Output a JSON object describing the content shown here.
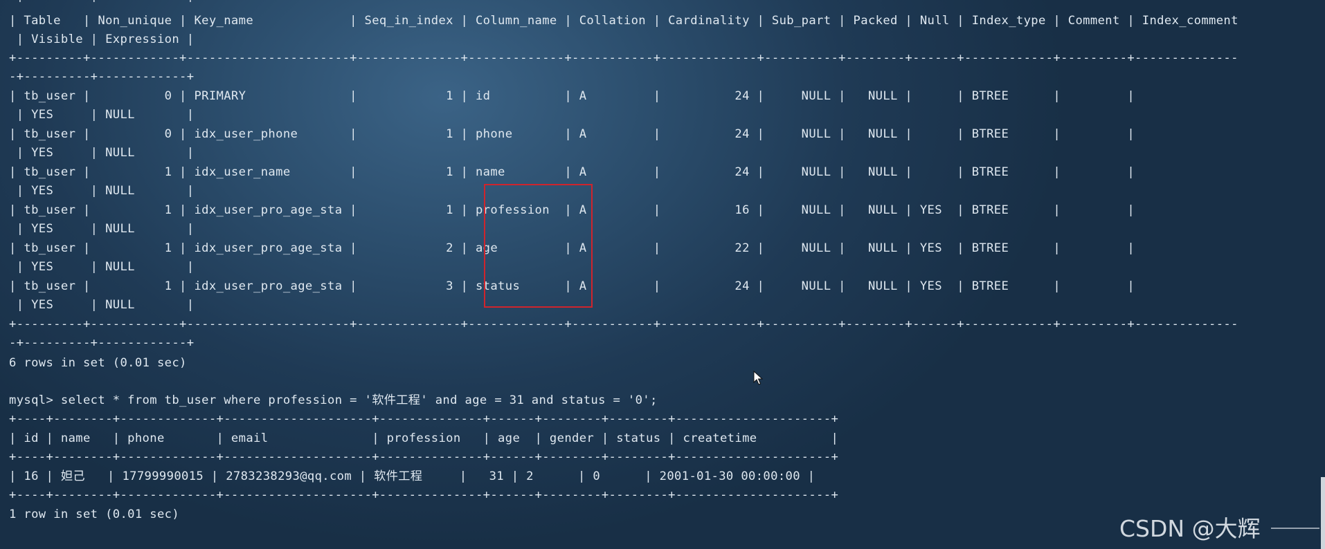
{
  "terminal": {
    "lines": [
      "-+---------+------------+",
      "| Table   | Non_unique | Key_name             | Seq_in_index | Column_name | Collation | Cardinality | Sub_part | Packed | Null | Index_type | Comment | Index_comment",
      " | Visible | Expression |",
      "+---------+------------+----------------------+--------------+-------------+-----------+-------------+----------+--------+------+------------+---------+--------------",
      "-+---------+------------+",
      "| tb_user |          0 | PRIMARY              |            1 | id          | A         |          24 |     NULL |   NULL |      | BTREE      |         |",
      " | YES     | NULL       |",
      "| tb_user |          0 | idx_user_phone       |            1 | phone       | A         |          24 |     NULL |   NULL |      | BTREE      |         |",
      " | YES     | NULL       |",
      "| tb_user |          1 | idx_user_name        |            1 | name        | A         |          24 |     NULL |   NULL |      | BTREE      |         |",
      " | YES     | NULL       |",
      "| tb_user |          1 | idx_user_pro_age_sta |            1 | profession  | A         |          16 |     NULL |   NULL | YES  | BTREE      |         |",
      " | YES     | NULL       |",
      "| tb_user |          1 | idx_user_pro_age_sta |            2 | age         | A         |          22 |     NULL |   NULL | YES  | BTREE      |         |",
      " | YES     | NULL       |",
      "| tb_user |          1 | idx_user_pro_age_sta |            3 | status      | A         |          24 |     NULL |   NULL | YES  | BTREE      |         |",
      " | YES     | NULL       |",
      "+---------+------------+----------------------+--------------+-------------+-----------+-------------+----------+--------+------+------------+---------+--------------",
      "-+---------+------------+",
      "6 rows in set (0.01 sec)",
      "",
      "mysql> select * from tb_user where profession = '软件工程' and age = 31 and status = '0';",
      "+----+--------+-------------+--------------------+--------------+------+--------+--------+---------------------+",
      "| id | name   | phone       | email              | profession   | age  | gender | status | createtime          |",
      "+----+--------+-------------+--------------------+--------------+------+--------+--------+---------------------+",
      "| 16 | 妲己   | 17799990015 | 2783238293@qq.com | 软件工程     |   31 | 2      | 0      | 2001-01-30 00:00:00 |",
      "+----+--------+-------------+--------------------+--------------+------+--------+--------+---------------------+",
      "1 row in set (0.01 sec)"
    ]
  },
  "watermark": {
    "text": "CSDN @大辉"
  },
  "colors": {
    "highlight": "#d0242c",
    "text": "#dfe8f0"
  },
  "icons": {
    "cursor": "mouse-pointer-icon"
  }
}
